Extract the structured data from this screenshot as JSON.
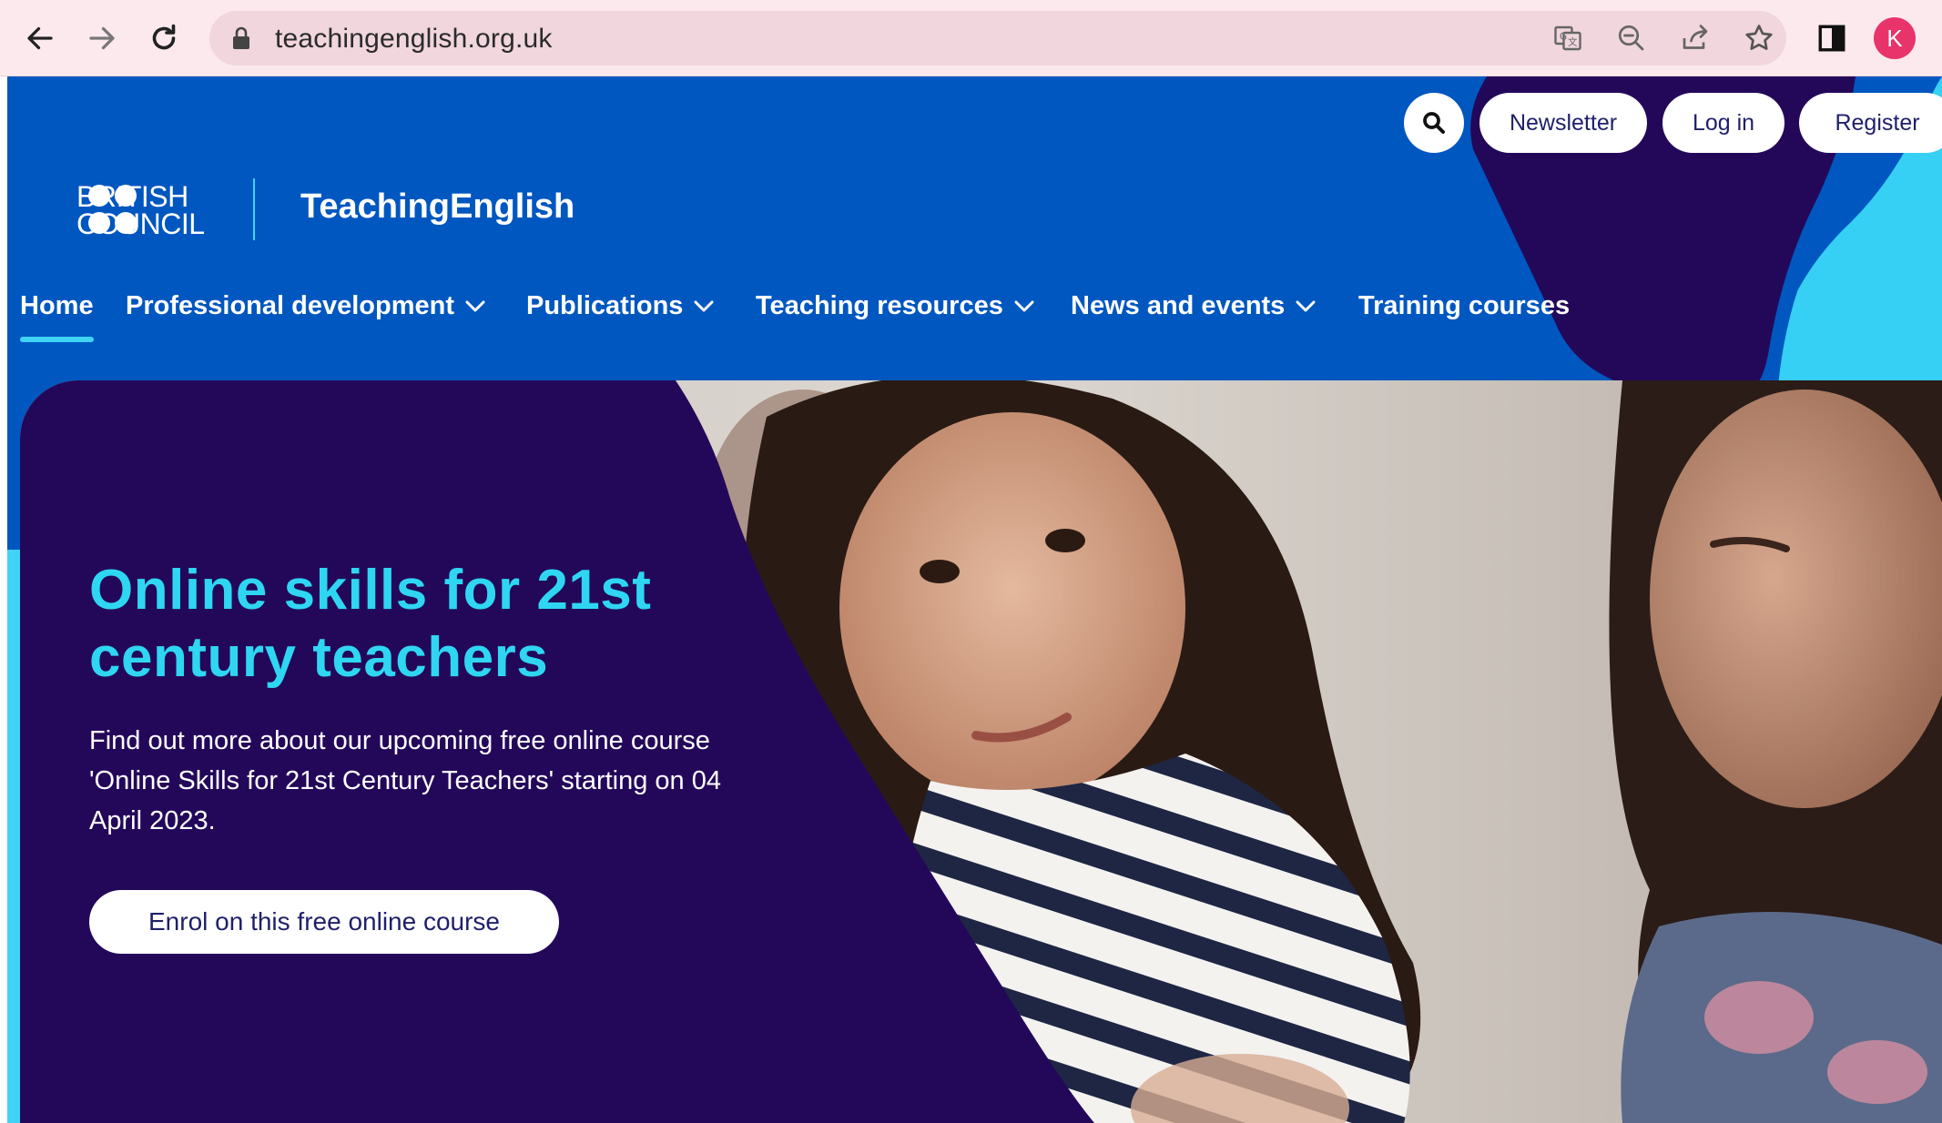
{
  "browser": {
    "url": "teachingenglish.org.uk",
    "profile_initial": "K"
  },
  "brand": {
    "logo_line1": "BRITISH",
    "logo_line2": "COUNCIL",
    "site_title": "TeachingEnglish"
  },
  "top_actions": {
    "newsletter": "Newsletter",
    "login": "Log in",
    "register": "Register"
  },
  "nav": {
    "items": [
      {
        "label": "Home",
        "dropdown": false
      },
      {
        "label": "Professional development",
        "dropdown": true
      },
      {
        "label": "Publications",
        "dropdown": true
      },
      {
        "label": "Teaching resources",
        "dropdown": true
      },
      {
        "label": "News and events",
        "dropdown": true
      },
      {
        "label": "Training courses",
        "dropdown": false
      }
    ]
  },
  "hero": {
    "title": "Online skills for 21st century teachers",
    "description": "Find out more about our upcoming free online course 'Online Skills for 21st Century Teachers' starting on 04 April 2023.",
    "cta": "Enrol on this free online course"
  },
  "colors": {
    "header_blue": "#0057c0",
    "deep_purple": "#23085a",
    "cyan": "#2fd6f2",
    "browser_pink": "#fbe9ee"
  }
}
